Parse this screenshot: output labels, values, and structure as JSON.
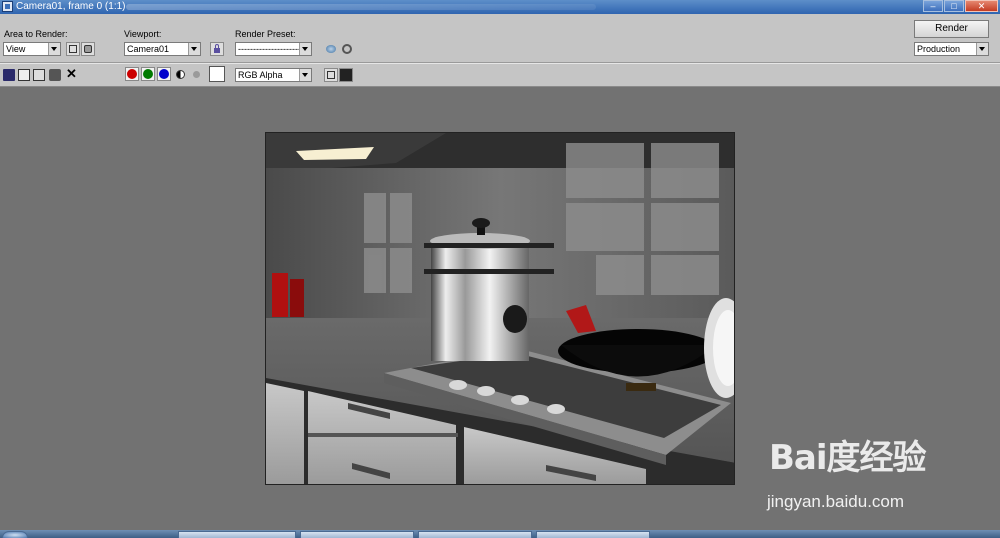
{
  "window": {
    "title": "Camera01, frame 0 (1:1)",
    "minimize_icon": "minimize-icon",
    "maximize_icon": "maximize-icon",
    "close_icon": "close-icon"
  },
  "area_to_render": {
    "label": "Area to Render:",
    "value": "View"
  },
  "viewport": {
    "label": "Viewport:",
    "value": "Camera01"
  },
  "render_preset": {
    "label": "Render Preset:",
    "value": "-----------------------------"
  },
  "render_button": {
    "label": "Render"
  },
  "render_mode": {
    "value": "Production"
  },
  "channel": {
    "value": "RGB Alpha"
  },
  "color_channels": {
    "red": "#cc0000",
    "green": "#007a00",
    "blue": "#0000cc"
  },
  "watermark": {
    "logo": "Bai度经验",
    "url": "jingyan.baidu.com"
  },
  "icons": [
    "save-icon",
    "copy-icon",
    "clone-icon",
    "print-icon",
    "clear-icon",
    "edit-region-icon",
    "auto-region-icon",
    "lock-icon",
    "environment-icon",
    "effects-icon",
    "alpha-toggle-icon",
    "mono-icon",
    "color-swatch-icon",
    "display-channel-icon",
    "display-alpha-icon"
  ]
}
